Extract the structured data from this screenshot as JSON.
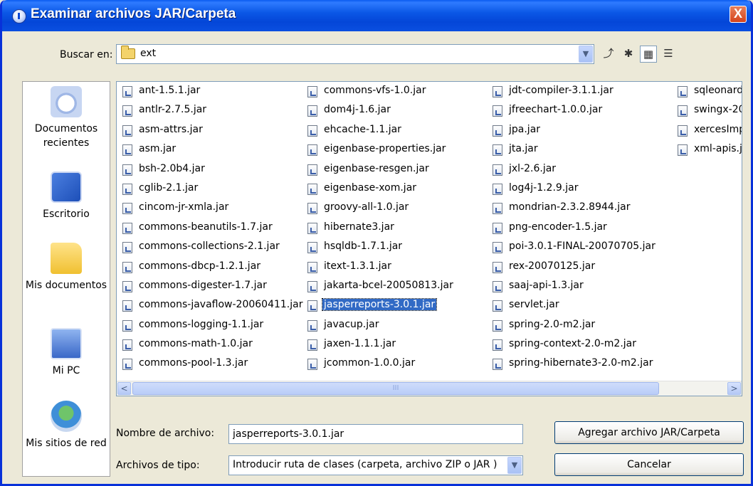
{
  "window": {
    "title": "Examinar archivos JAR/Carpeta",
    "close_label": "X"
  },
  "lookin": {
    "label": "Buscar en:",
    "value": "ext"
  },
  "toolbar": {
    "up_icon": "up-folder-icon",
    "new_folder_icon": "new-folder-icon",
    "list_icon": "list-view-icon",
    "details_icon": "details-view-icon"
  },
  "places": [
    {
      "label": "Documentos recientes",
      "icon": "recent-documents-icon"
    },
    {
      "label": "Escritorio",
      "icon": "desktop-icon"
    },
    {
      "label": "Mis documentos",
      "icon": "my-documents-icon"
    },
    {
      "label": "Mi PC",
      "icon": "my-computer-icon"
    },
    {
      "label": "Mis sitios de red",
      "icon": "network-places-icon"
    }
  ],
  "files": {
    "columns": [
      [
        "ant-1.5.1.jar",
        "antlr-2.7.5.jar",
        "asm-attrs.jar",
        "asm.jar",
        "bsh-2.0b4.jar",
        "cglib-2.1.jar",
        "cincom-jr-xmla.jar",
        "commons-beanutils-1.7.jar",
        "commons-collections-2.1.jar",
        "commons-dbcp-1.2.1.jar",
        "commons-digester-1.7.jar",
        "commons-javaflow-20060411.jar",
        "commons-logging-1.1.jar",
        "commons-math-1.0.jar",
        "commons-pool-1.3.jar"
      ],
      [
        "commons-vfs-1.0.jar",
        "dom4j-1.6.jar",
        "ehcache-1.1.jar",
        "eigenbase-properties.jar",
        "eigenbase-resgen.jar",
        "eigenbase-xom.jar",
        "groovy-all-1.0.jar",
        "hibernate3.jar",
        "hsqldb-1.7.1.jar",
        "itext-1.3.1.jar",
        "jakarta-bcel-20050813.jar",
        "jasperreports-3.0.1.jar",
        "javacup.jar",
        "jaxen-1.1.1.jar",
        "jcommon-1.0.0.jar"
      ],
      [
        "jdt-compiler-3.1.1.jar",
        "jfreechart-1.0.0.jar",
        "jpa.jar",
        "jta.jar",
        "jxl-2.6.jar",
        "log4j-1.2.9.jar",
        "mondrian-2.3.2.8944.jar",
        "png-encoder-1.5.jar",
        "poi-3.0.1-FINAL-20070705.jar",
        "rex-20070125.jar",
        "saaj-api-1.3.jar",
        "servlet.jar",
        "spring-2.0-m2.jar",
        "spring-context-2.0-m2.jar",
        "spring-hibernate3-2.0-m2.jar"
      ],
      [
        "sqleonard",
        "swingx-20",
        "xercesImp",
        "xml-apis.j"
      ]
    ],
    "selected": "jasperreports-3.0.1.jar"
  },
  "scrollbar": {
    "left": "<",
    "right": ">",
    "grip": "III"
  },
  "filename": {
    "label": "Nombre de archivo:",
    "value": "jasperreports-3.0.1.jar"
  },
  "filetype": {
    "label": "Archivos de tipo:",
    "value": "Introducir ruta de clases (carpeta, archivo ZIP o JAR )"
  },
  "buttons": {
    "accept": "Agregar archivo JAR/Carpeta",
    "cancel": "Cancelar"
  }
}
